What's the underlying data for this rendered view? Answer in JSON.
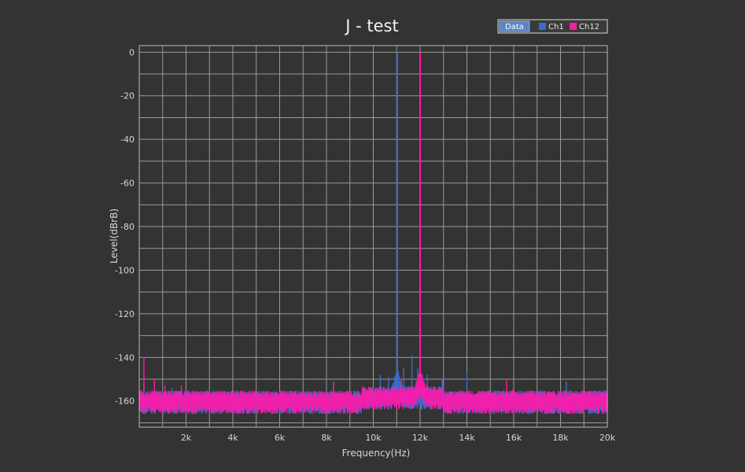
{
  "chart_data": {
    "type": "line",
    "title": "J - test",
    "xlabel": "Frequency(Hz)",
    "ylabel": "Level(dBrB)",
    "xlim": [
      0,
      20000
    ],
    "ylim": [
      -172,
      3
    ],
    "x_ticks": [
      2000,
      4000,
      6000,
      8000,
      10000,
      12000,
      14000,
      16000,
      18000,
      20000
    ],
    "x_tick_labels": [
      "2k",
      "4k",
      "6k",
      "8k",
      "10k",
      "12k",
      "14k",
      "16k",
      "18k",
      "20k"
    ],
    "y_ticks": [
      0,
      -20,
      -40,
      -60,
      -80,
      -100,
      -120,
      -140,
      -160
    ],
    "y_tick_labels": [
      "0",
      "-20",
      "-40",
      "-60",
      "-80",
      "-100",
      "-120",
      "-140",
      "-160"
    ],
    "grid": true,
    "legend": {
      "placement": "top-right",
      "button_label": "Data",
      "entries": [
        "Ch1",
        "Ch12"
      ]
    },
    "colors": {
      "background": "#333333",
      "grid": "#9a9a9a",
      "ch1": "#3a6bd4",
      "ch12": "#ff1aa8"
    },
    "series": [
      {
        "name": "Ch1",
        "noise_floor": -160,
        "noise_spread": 6,
        "x": [
          11025,
          200,
          650,
          1400,
          2000,
          8300,
          9600,
          10300,
          10650,
          10800,
          11300,
          11650,
          11900,
          12300,
          12950,
          14000,
          18250,
          19900
        ],
        "y": [
          0,
          -152,
          -155,
          -154,
          -155,
          -153,
          -154,
          -148,
          -149,
          -153,
          -145,
          -139,
          -145,
          -148,
          -150,
          -147,
          -151,
          -155
        ]
      },
      {
        "name": "Ch12",
        "noise_floor": -160,
        "noise_spread": 6,
        "x": [
          12000,
          80,
          200,
          650,
          1100,
          1800,
          8300,
          11200,
          12300,
          15700,
          15950,
          16800,
          19900
        ],
        "y": [
          0,
          -155,
          -140,
          -150,
          -153,
          -153,
          -151,
          -150,
          -152,
          -150,
          -155,
          -156,
          -156
        ]
      }
    ]
  }
}
